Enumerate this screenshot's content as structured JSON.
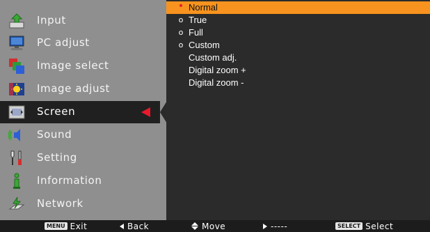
{
  "colors": {
    "menu_bg": "#8f8f8f",
    "panel_bg": "#2b2b2b",
    "highlight": "#f7931e",
    "pointer": "#e8192c",
    "bottom_bar": "#1c1c1c"
  },
  "menu": {
    "items": [
      {
        "label": "Input",
        "icon": "input-icon"
      },
      {
        "label": "PC adjust",
        "icon": "pc-adjust-icon"
      },
      {
        "label": "Image select",
        "icon": "image-select-icon"
      },
      {
        "label": "Image adjust",
        "icon": "image-adjust-icon"
      },
      {
        "label": "Screen",
        "icon": "screen-icon"
      },
      {
        "label": "Sound",
        "icon": "sound-icon"
      },
      {
        "label": "Setting",
        "icon": "setting-icon"
      },
      {
        "label": "Information",
        "icon": "information-icon"
      },
      {
        "label": "Network",
        "icon": "network-icon"
      }
    ],
    "selected": "Screen"
  },
  "panel": {
    "items": [
      {
        "label": "Normal",
        "mark": "•"
      },
      {
        "label": "True",
        "mark": "o"
      },
      {
        "label": "Full",
        "mark": "o"
      },
      {
        "label": "Custom",
        "mark": "o"
      },
      {
        "label": "Custom adj.",
        "mark": ""
      },
      {
        "label": "Digital zoom +",
        "mark": ""
      },
      {
        "label": "Digital zoom -",
        "mark": ""
      }
    ],
    "highlighted": "Normal"
  },
  "bottom_bar": {
    "exit": {
      "key": "MENU",
      "label": "Exit"
    },
    "back": {
      "label": "Back"
    },
    "move": {
      "label": "Move"
    },
    "next": {
      "label": "-----"
    },
    "select": {
      "key": "SELECT",
      "label": "Select"
    }
  }
}
